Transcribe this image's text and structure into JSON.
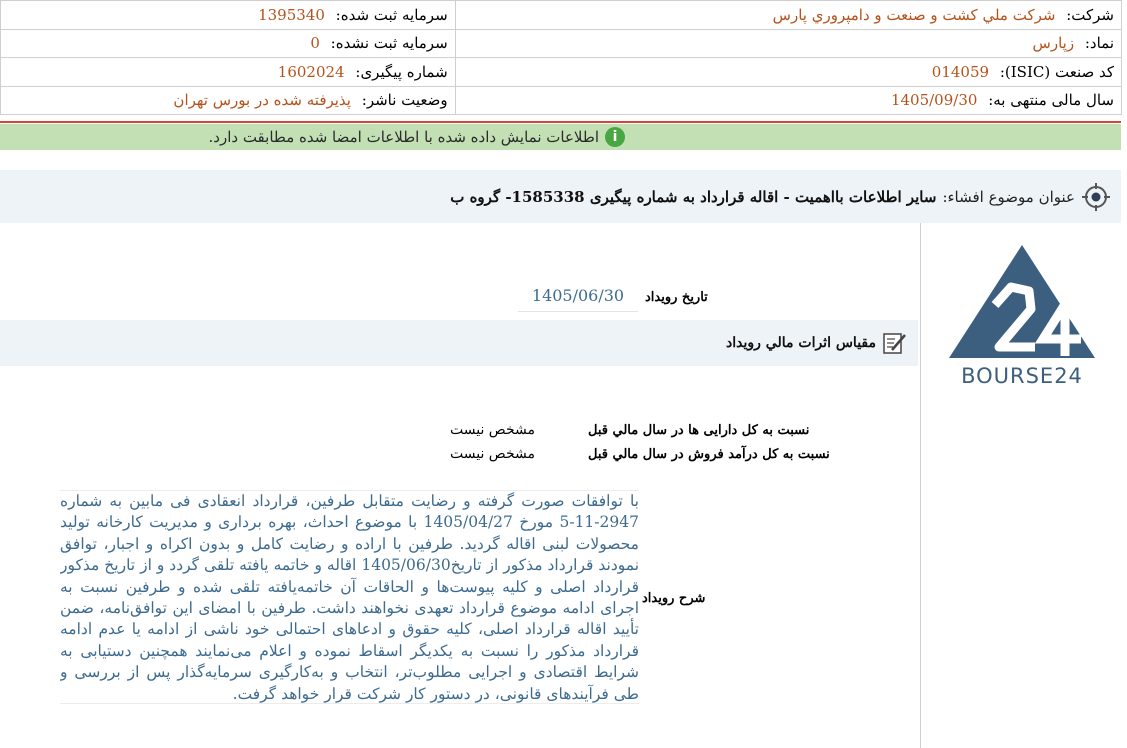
{
  "header": {
    "company_label": "شرکت:",
    "company_value": "شركت ملي كشت و صنعت و دامپروري پارس",
    "registered_capital_label": "سرمایه ثبت شده:",
    "registered_capital_value": "1395340",
    "symbol_label": "نماد:",
    "symbol_value": "زپارس",
    "unregistered_capital_label": "سرمایه ثبت نشده:",
    "unregistered_capital_value": "0",
    "isic_label": "کد صنعت (ISIC):",
    "isic_value": "014059",
    "tracking_label": "شماره پیگیری:",
    "tracking_value": "1602024",
    "fiscal_year_label": "سال مالی منتهی به:",
    "fiscal_year_value": "1405/09/30",
    "publisher_status_label": "وضعیت ناشر:",
    "publisher_status_value": "پذیرفته شده در بورس تهران"
  },
  "notice": {
    "icon": "info-icon",
    "text": "اطلاعات نمایش داده شده با اطلاعات امضا شده مطابقت دارد."
  },
  "subject": {
    "label": "عنوان موضوع افشاء:",
    "value": "سایر اطلاعات بااهمیت - اقاله قرارداد به شماره پیگیری 1585338- گروه ب"
  },
  "logo": {
    "text": "BOURSE24",
    "color": "#3c5f7f"
  },
  "event": {
    "date_label": "تاریخ رویداد",
    "date_value": "1405/06/30",
    "effects_title": "مقیاس اثرات مالي رویداد",
    "ratio_assets_label": "نسبت به کل دارایی ها در سال مالي قبل",
    "ratio_assets_value": "مشخص نیست",
    "ratio_revenue_label": "نسبت به کل درآمد فروش در سال مالي قبل",
    "ratio_revenue_value": "مشخص نیست",
    "description_label": "شرح رویداد",
    "description_text": "با توافقات صورت گرفته و رضایت متقابل طرفین، قرارداد انعقادی فی مابین به شماره 2947-11-5 مورخ 1405/04/27 با موضوع احداث، بهره برداری و مدیریت کارخانه تولید محصولات لبنی اقاله گردید. طرفین با اراده و رضایت کامل و بدون اکراه و اجبار، توافق نمودند قرارداد مذکور از تاریخ1405/06/30 اقاله و خاتمه یافته تلقی گردد و از تاریخ مذکور قرارداد اصلی و کلیه پیوست‌ها و الحاقات آن خاتمه‌یافته تلقی شده و طرفین نسبت به اجرای ادامه موضوع قرارداد تعهدی نخواهند داشت. طرفین با امضای این توافق‌نامه، ضمن تأیید اقاله قرارداد اصلی، کلیه حقوق و ادعاهای احتمالی خود ناشی از ادامه یا عدم ادامه قرارداد مذکور را نسبت به یکدیگر اسقاط نموده و اعلام می‌نمایند همچنین دستیابی به شرایط اقتصادی و اجرایی مطلوب‌تر، انتخاب و به‌کارگیری سرمایه‌گذار پس از بررسی و طی فرآیندهای قانونی، در دستور کار شرکت قرار خواهد گرفت."
  }
}
